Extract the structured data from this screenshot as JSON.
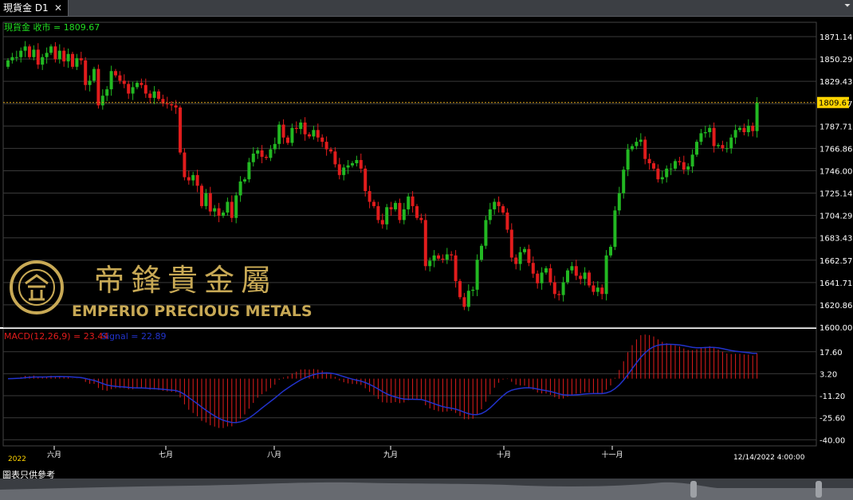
{
  "window": {
    "tab_title": "現貨金 D1",
    "close_glyph": "✕",
    "menu_glyph": "⏷"
  },
  "price_legend": "現貨金 收市 = 1809.67",
  "macd_legend": {
    "macd_text": "MACD(12,26,9) = 23.44",
    "signal_text": "Signal = 22.89"
  },
  "footer_note": "圖表只供參考",
  "watermark": {
    "chinese": "帝鋒貴金屬",
    "english": "EMPERIO PRECIOUS METALS"
  },
  "colors": {
    "up": "#22b822",
    "down": "#e11c1c",
    "grid": "#3a3a3a",
    "axis_text": "#ffffff",
    "legend_green": "#22dd22",
    "macd_red": "#e11c1c",
    "signal_blue": "#2233cc",
    "current_price_bg": "#ffd400",
    "gold": "#c8a955"
  },
  "chart_data": [
    {
      "type": "candlestick",
      "title": "現貨金 D1",
      "timeframe": "D1",
      "last_close": 1809.67,
      "y_tick_labels": [
        "1871.14",
        "1850.29",
        "1829.43",
        "1808.57",
        "1787.71",
        "1766.86",
        "1746.00",
        "1725.14",
        "1704.29",
        "1683.43",
        "1662.57",
        "1641.71",
        "1620.86",
        "1600.00"
      ],
      "ylim": [
        1600.0,
        1871.14
      ],
      "x_tick_labels": [
        "六月",
        "七月",
        "八月",
        "九月",
        "十月",
        "十一月"
      ],
      "x_year_label": "2022",
      "last_time_label": "12/14/2022 4:00:00",
      "grid": true,
      "closes": [
        1849,
        1852,
        1852,
        1858,
        1862,
        1852,
        1859,
        1845,
        1852,
        1856,
        1862,
        1850,
        1858,
        1848,
        1855,
        1843,
        1851,
        1849,
        1826,
        1830,
        1841,
        1807,
        1816,
        1822,
        1839,
        1835,
        1830,
        1827,
        1818,
        1824,
        1828,
        1826,
        1818,
        1814,
        1820,
        1813,
        1809,
        1808,
        1807,
        1805,
        1763,
        1740,
        1737,
        1742,
        1732,
        1713,
        1725,
        1708,
        1711,
        1704,
        1707,
        1717,
        1702,
        1723,
        1736,
        1738,
        1754,
        1762,
        1765,
        1759,
        1758,
        1766,
        1771,
        1789,
        1777,
        1772,
        1786,
        1785,
        1791,
        1780,
        1778,
        1784,
        1777,
        1773,
        1766,
        1764,
        1752,
        1742,
        1749,
        1751,
        1753,
        1756,
        1748,
        1727,
        1717,
        1713,
        1700,
        1696,
        1712,
        1710,
        1716,
        1700,
        1710,
        1722,
        1713,
        1702,
        1700,
        1657,
        1662,
        1667,
        1664,
        1663,
        1668,
        1667,
        1643,
        1628,
        1619,
        1634,
        1635,
        1663,
        1676,
        1700,
        1710,
        1717,
        1713,
        1707,
        1691,
        1665,
        1659,
        1670,
        1673,
        1660,
        1650,
        1641,
        1651,
        1655,
        1642,
        1631,
        1630,
        1642,
        1653,
        1657,
        1648,
        1645,
        1651,
        1639,
        1633,
        1637,
        1631,
        1667,
        1675,
        1709,
        1725,
        1747,
        1766,
        1769,
        1773,
        1775,
        1757,
        1753,
        1748,
        1738,
        1740,
        1748,
        1748,
        1755,
        1754,
        1747,
        1750,
        1761,
        1773,
        1781,
        1782,
        1786,
        1769,
        1770,
        1767,
        1767,
        1777,
        1784,
        1786,
        1782,
        1788,
        1783,
        1809.67
      ],
      "series": [
        {
          "name": "MACD(12,26,9)",
          "last": 23.44
        },
        {
          "name": "Signal",
          "last": 22.89
        }
      ],
      "macd_y_tick_labels": [
        "17.60",
        "3.20",
        "-11.20",
        "-25.60",
        "-40.00"
      ],
      "macd_ylim": [
        -44,
        30
      ]
    }
  ]
}
